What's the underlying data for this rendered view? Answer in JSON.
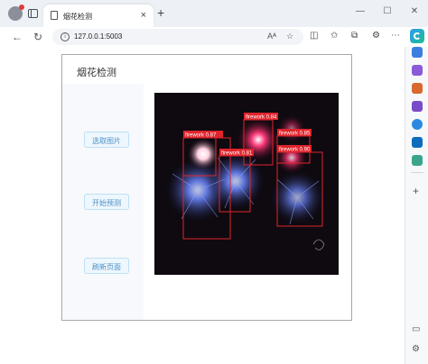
{
  "browser": {
    "tab_title": "烟花检测",
    "url": "127.0.0.1:5003",
    "colors": {
      "edge_accent": "#1e90f0"
    }
  },
  "app": {
    "title": "烟花检测",
    "buttons": {
      "select_image": "选取图片",
      "start_predict": "开始预测",
      "refresh_page": "刷新页面"
    },
    "colors": {
      "button_bg": "#eef7fd",
      "button_border": "#bfe0f7",
      "button_text": "#4a90c6",
      "box_color": "#e0242c"
    },
    "detections": [
      {
        "label": "firework 0.87"
      },
      {
        "label": "firework 0.81"
      },
      {
        "label": "firework 0.84"
      },
      {
        "label": "firework 0.85"
      },
      {
        "label": "firework 0.90"
      }
    ]
  }
}
